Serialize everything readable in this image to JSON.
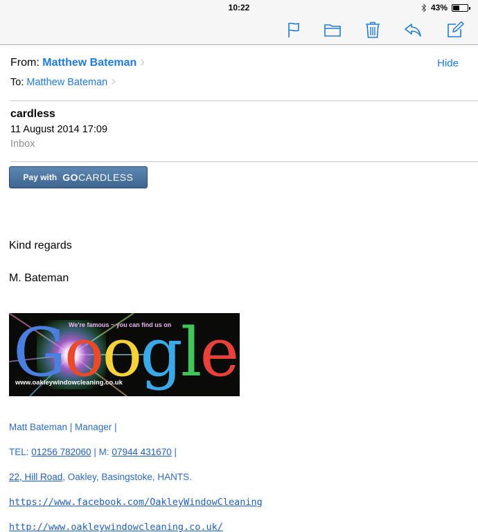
{
  "status_bar": {
    "time": "10:22",
    "battery_text": "43%",
    "battery_level": 0.43,
    "bluetooth_icon": "bluetooth-icon"
  },
  "toolbar": {
    "icons": [
      "flag-icon",
      "folder-icon",
      "trash-icon",
      "reply-icon",
      "compose-icon"
    ],
    "accent": "#1e7bd9"
  },
  "message": {
    "from_label": "From:",
    "from_name": "Matthew Bateman",
    "hide_label": "Hide",
    "to_label": "To:",
    "to_name": "Matthew Bateman",
    "subject": "cardless",
    "date": "11 August 2014 17:09",
    "mailbox": "Inbox"
  },
  "pay_button": {
    "pay_with": "Pay with",
    "logo_bold": "GO",
    "logo_rest": "CARDLESS"
  },
  "body": {
    "kind_regards": "Kind regards",
    "signoff": "M. Bateman"
  },
  "banner": {
    "tagline": "We're famous ~ you can find us on",
    "letters": [
      "G",
      "o",
      "o",
      "g",
      "l",
      "e"
    ],
    "letter_colors": [
      "#4a7fe0",
      "#e84a2a",
      "#f5d23a",
      "#3ba8e8",
      "#42c25a",
      "#e8413a"
    ],
    "url": "www.oakleywindowcleaning.co.uk"
  },
  "signature": {
    "name_line": "Matt Bateman | Manager |",
    "tel_label": "TEL:",
    "tel_number": "01256 782060",
    "mobile_label": "| M:",
    "mobile_number": "07944 431670",
    "tel_tail": "|",
    "address_link": "22, Hill Road",
    "address_rest": ", Oakley, Basingstoke, HANTS.",
    "facebook_url": "https://www.facebook.com/OakleyWindowCleaning",
    "website_url": "http://www.oakleywindowcleaning.co.uk/"
  }
}
